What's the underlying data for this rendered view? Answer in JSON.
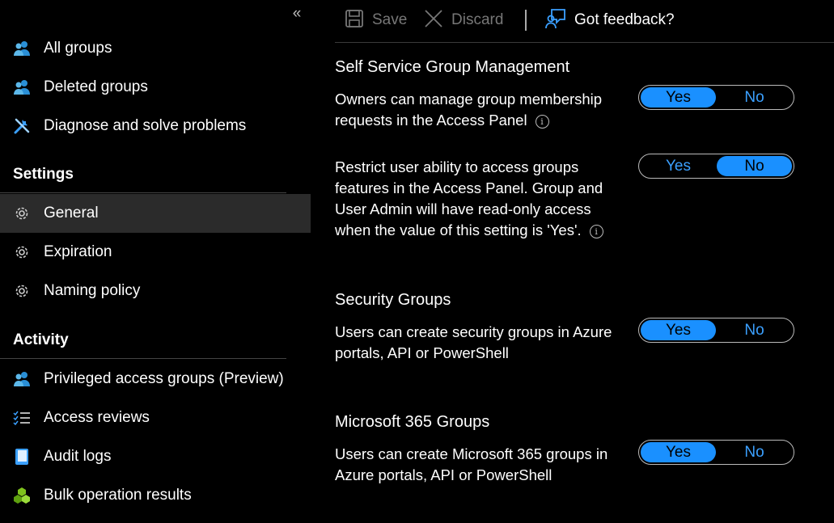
{
  "sidebar": {
    "collapse_glyph": "«",
    "items_top": [
      {
        "label": "All groups",
        "icon": "users-icon"
      },
      {
        "label": "Deleted groups",
        "icon": "users-icon"
      },
      {
        "label": "Diagnose and solve problems",
        "icon": "wrench-icon"
      }
    ],
    "settings": {
      "heading": "Settings",
      "items": [
        {
          "label": "General",
          "icon": "gear-icon",
          "active": true
        },
        {
          "label": "Expiration",
          "icon": "gear-icon"
        },
        {
          "label": "Naming policy",
          "icon": "gear-icon"
        }
      ]
    },
    "activity": {
      "heading": "Activity",
      "items": [
        {
          "label": "Privileged access groups (Preview)",
          "icon": "users-icon"
        },
        {
          "label": "Access reviews",
          "icon": "checklist-icon"
        },
        {
          "label": "Audit logs",
          "icon": "book-icon"
        },
        {
          "label": "Bulk operation results",
          "icon": "cubes-icon"
        }
      ]
    }
  },
  "toolbar": {
    "save_label": "Save",
    "discard_label": "Discard",
    "feedback_label": "Got feedback?"
  },
  "groups": [
    {
      "title": "Self Service Group Management",
      "settings": [
        {
          "desc": "Owners can manage group membership requests in the Access Panel",
          "value": "Yes"
        },
        {
          "desc": "Restrict user ability to access groups features in the Access Panel. Group and User Admin will have read-only access when the value of this setting is 'Yes'.",
          "value": "No"
        }
      ]
    },
    {
      "title": "Security Groups",
      "settings": [
        {
          "desc": "Users can create security groups in Azure portals, API or PowerShell",
          "value": "Yes"
        }
      ]
    },
    {
      "title": "Microsoft 365 Groups",
      "settings": [
        {
          "desc": "Users can create Microsoft 365 groups in Azure portals, API or PowerShell",
          "value": "Yes"
        }
      ]
    }
  ],
  "toggle_labels": {
    "yes": "Yes",
    "no": "No"
  },
  "colors": {
    "accent": "#1a90ff",
    "accent_text": "#3ba0ff",
    "active_row": "#2b2b2b"
  }
}
